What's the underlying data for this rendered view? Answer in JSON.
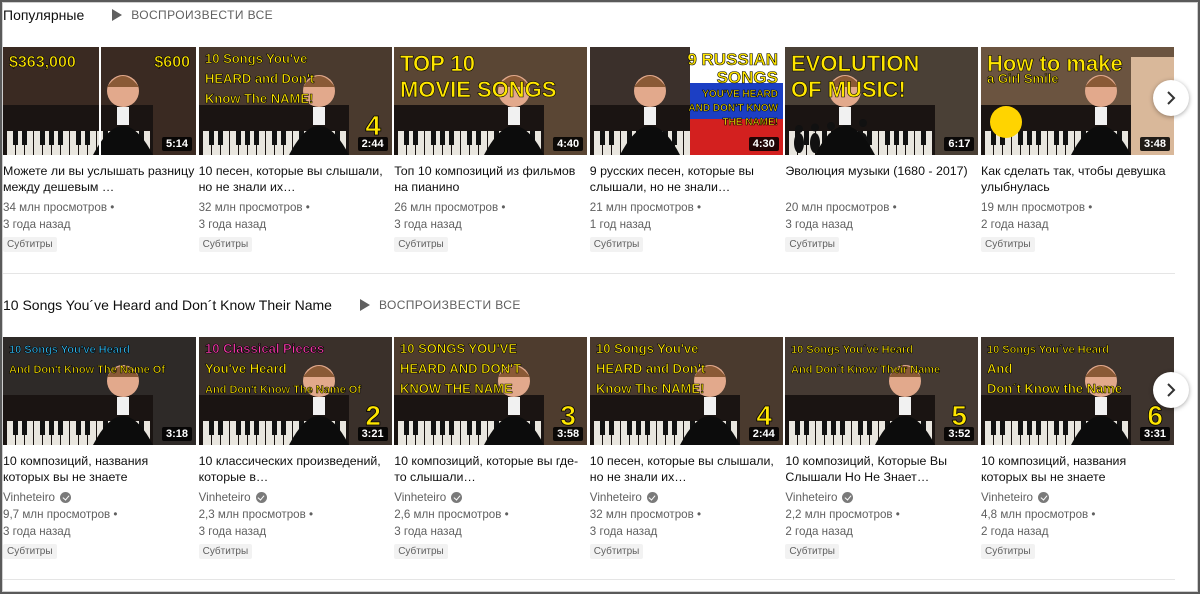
{
  "shelves": [
    {
      "title": "Популярные",
      "play_all_label": "ВОСПРОИЗВЕСТИ ВСЕ",
      "videos": [
        {
          "title": "Можете ли вы услышать разницу между дешевым …",
          "channel": "",
          "views": "34 млн просмотров •",
          "age": "3 года назад",
          "badge": "Субтитры",
          "duration": "5:14",
          "thumb": {
            "bg": "#3a2a22",
            "lines": [
              "$363,000",
              "$600"
            ],
            "color": "#ffe600",
            "layout": "split"
          }
        },
        {
          "title": "10 песен, которые вы слышали, но не знали их…",
          "channel": "",
          "views": "32 млн просмотров •",
          "age": "3 года назад",
          "badge": "Субтитры",
          "duration": "2:44",
          "thumb": {
            "bg": "#4a3a2e",
            "lines": [
              "10 Songs You've",
              "HEARD and Don't",
              "Know The NAME!"
            ],
            "color": "#ffe600",
            "number": "4"
          }
        },
        {
          "title": "Топ 10 композиций из фильмов на пианино",
          "channel": "",
          "views": "26 млн просмотров •",
          "age": "3 года назад",
          "badge": "Субтитры",
          "duration": "4:40",
          "thumb": {
            "bg": "#5a4634",
            "lines": [
              "TOP 10",
              "MOVIE SONGS"
            ],
            "color": "#ffe600"
          }
        },
        {
          "title": "9 русских песен, которые вы слышали, но не знали…",
          "channel": "",
          "views": "21 млн просмотров •",
          "age": "1 год назад",
          "badge": "Субтитры",
          "duration": "4:30",
          "thumb": {
            "bg": "#3b302b",
            "lines": [
              "9 RUSSIAN",
              "SONGS",
              "YOU'VE HEARD",
              "AND DON'T KNOW",
              "THE NAME!"
            ],
            "color": "#ffe600",
            "layout": "flag"
          }
        },
        {
          "title": "Эволюция музыки (1680 - 2017)",
          "channel": "",
          "views": "20 млн просмотров •",
          "age": "3 года назад",
          "badge": "Субтитры",
          "duration": "6:17",
          "thumb": {
            "bg": "#4a4036",
            "lines": [
              "EVOLUTION",
              "OF MUSIC!"
            ],
            "color": "#ffe600",
            "layout": "evolution"
          }
        },
        {
          "title": "Как сделать так, чтобы девушка улыбнулась",
          "channel": "",
          "views": "19 млн просмотров •",
          "age": "2 года назад",
          "badge": "Субтитры",
          "duration": "3:48",
          "thumb": {
            "bg": "#6b5440",
            "lines": [
              "How to make",
              "a Girl Smile"
            ],
            "color": "#ffe600",
            "layout": "smile"
          }
        }
      ]
    },
    {
      "title": "10 Songs You´ve Heard and Don´t Know Their Name",
      "play_all_label": "ВОСПРОИЗВЕСТИ ВСЕ",
      "videos": [
        {
          "title": "10 композиций, названия которых вы не знаете",
          "channel": "Vinheteiro",
          "views": "9,7 млн просмотров •",
          "age": "3 года назад",
          "badge": "Субтитры",
          "duration": "3:18",
          "thumb": {
            "bg": "#2e2a28",
            "lines": [
              "10 Songs You've Heard",
              "And Don't Know The Name Of"
            ],
            "color": "#33c3ff",
            "color2": "#ffe600"
          }
        },
        {
          "title": "10 классических произведений, которые в…",
          "channel": "Vinheteiro",
          "views": "2,3 млн просмотров •",
          "age": "3 года назад",
          "badge": "Субтитры",
          "duration": "3:21",
          "thumb": {
            "bg": "#3a302a",
            "lines": [
              "10 Classical Pieces",
              "You've Heard",
              "And Don't Know The Name Of"
            ],
            "color": "#ff3bb0",
            "color2": "#ffe600",
            "number": "2"
          }
        },
        {
          "title": "10 композиций, которые вы где-то слышали…",
          "channel": "Vinheteiro",
          "views": "2,6 млн просмотров •",
          "age": "3 года назад",
          "badge": "Субтитры",
          "duration": "3:58",
          "thumb": {
            "bg": "#4e3c2e",
            "lines": [
              "10 SONGS YOU'VE",
              "HEARD AND DON'T",
              "KNOW THE NAME"
            ],
            "color": "#ffe600",
            "number": "3"
          }
        },
        {
          "title": "10 песен, которые вы слышали, но не знали их…",
          "channel": "Vinheteiro",
          "views": "32 млн просмотров •",
          "age": "3 года назад",
          "badge": "Субтитры",
          "duration": "2:44",
          "thumb": {
            "bg": "#4a3a2e",
            "lines": [
              "10 Songs You've",
              "HEARD and Don't",
              "Know The NAME!"
            ],
            "color": "#ffe600",
            "number": "4"
          }
        },
        {
          "title": "10 композиций, Которые Вы Слышали Но Не Знает…",
          "channel": "Vinheteiro",
          "views": "2,2 млн просмотров •",
          "age": "2 года назад",
          "badge": "Субтитры",
          "duration": "3:52",
          "thumb": {
            "bg": "#453a33",
            "lines": [
              "10 Songs You´ve Heard",
              "And Don´t Know Their Name"
            ],
            "color": "#ffe600",
            "number": "5"
          }
        },
        {
          "title": "10 композиций, названия которых вы не знаете",
          "channel": "Vinheteiro",
          "views": "4,8 млн просмотров •",
          "age": "2 года назад",
          "badge": "Субтитры",
          "duration": "3:31",
          "thumb": {
            "bg": "#3e342e",
            "lines": [
              "10 Songs You´ve Heard",
              "And",
              "Don´t Know the Name"
            ],
            "color": "#ffe600",
            "number": "6"
          }
        }
      ]
    }
  ],
  "icons": {
    "play": "play-icon",
    "next": "chevron-right-icon",
    "verified": "verified-check-icon"
  }
}
